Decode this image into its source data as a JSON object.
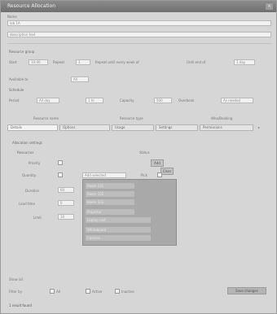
{
  "window": {
    "title": "Resource Allocation",
    "close_glyph": "×"
  },
  "general": {
    "name_label": "Name",
    "name_value": "lab 1A",
    "description_value": "description text",
    "group_label": "Resource group"
  },
  "row1": {
    "start_label": "Start",
    "start_value": "10:00",
    "repeat_label": "Repeat",
    "repeat_value": "1",
    "long_label": "Repeat until every week of",
    "until_label": "Until end of",
    "until_value": "1 day"
  },
  "availability": {
    "label": "Available to",
    "value": "All"
  },
  "schedule": {
    "header": "Schedule",
    "period_label": "Period",
    "period_value": "All day",
    "val2": "1 hr",
    "label3": "Capacity",
    "val3": "500",
    "label4": "Overbook",
    "val4": "As needed"
  },
  "columns": {
    "a": "Resource name",
    "b": "Resource type",
    "c": "Who/Booking"
  },
  "tabs": [
    {
      "label": "Details"
    },
    {
      "label": "Options"
    },
    {
      "label": "Usage"
    },
    {
      "label": "Settings"
    },
    {
      "label": "Permissions"
    }
  ],
  "panel": {
    "section_title": "Allocation settings",
    "subsection": "Resources",
    "status_label": "Status",
    "rows": [
      {
        "label": "Priority",
        "value": "1"
      },
      {
        "label": "Quantity",
        "value": "1"
      },
      {
        "label": "Duration",
        "value": "60"
      },
      {
        "label": "Lead time",
        "value": "0"
      },
      {
        "label": "Limit",
        "value": "10"
      }
    ],
    "btn_small": "Add",
    "btn_small2": "Clear",
    "dropdown_value": "Add selected",
    "side_label": "Pick",
    "picklist_items": [
      "Room 101",
      "Room 102",
      "Room 103",
      "Projector",
      "Laptop cart",
      "Whiteboard",
      "Camera"
    ]
  },
  "footer": {
    "note": "Show all",
    "filter_label": "Filter by",
    "opt_a": "All",
    "opt_b": "Active",
    "opt_c": "Inactive",
    "action_button": "Save changes",
    "status_text": "1 result found"
  }
}
